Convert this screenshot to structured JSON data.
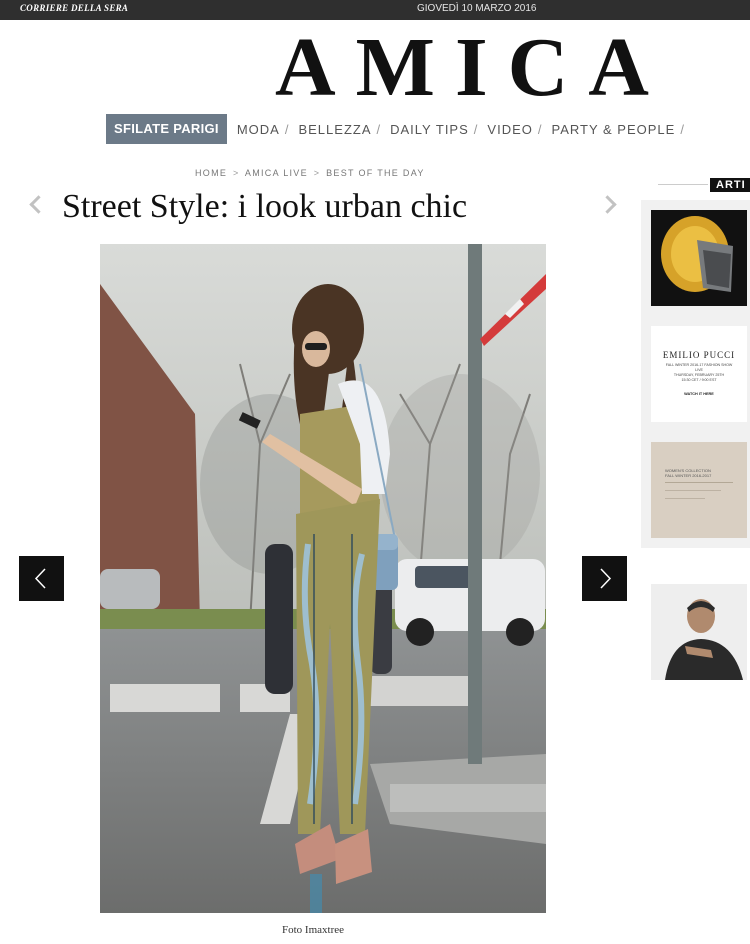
{
  "topbar": {
    "brand": "CORRIERE DELLA SERA",
    "date": "GIOVEDÌ 10 MARZO 2016"
  },
  "logo": "AMICA",
  "nav": {
    "active": "SFILATE PARIGI",
    "items": [
      "MODA",
      "BELLEZZA",
      "DAILY TIPS",
      "VIDEO",
      "PARTY & PEOPLE"
    ],
    "separator": "/"
  },
  "breadcrumb": [
    "HOME",
    "AMICA LIVE",
    "BEST OF THE DAY"
  ],
  "breadcrumb_separator": ">",
  "article": {
    "title": "Street Style: i look urban chic",
    "photo_credit": "Foto Imaxtree"
  },
  "sidebar": {
    "tab_label": "ARTI",
    "thumb2": {
      "title": "EMILIO PUCCI",
      "line1": "FALL WINTER 2016-17 FASHION SHOW",
      "line2": "LIVE",
      "line3": "THURSDAY, FEBRUARY 25TH",
      "line4": "15:30 CET / 9:00 EST",
      "cta": "WATCH IT HERE"
    },
    "thumb3": {
      "line1": "WOMEN'S COLLECTION",
      "line2": "FALL WINTER 2016-2017"
    }
  },
  "icons": {
    "prev": "chevron-left-icon",
    "next": "chevron-right-icon"
  },
  "colors": {
    "topbar": "#2f2f2f",
    "nav_active": "#6c7a88",
    "arrow_button": "#111111"
  }
}
